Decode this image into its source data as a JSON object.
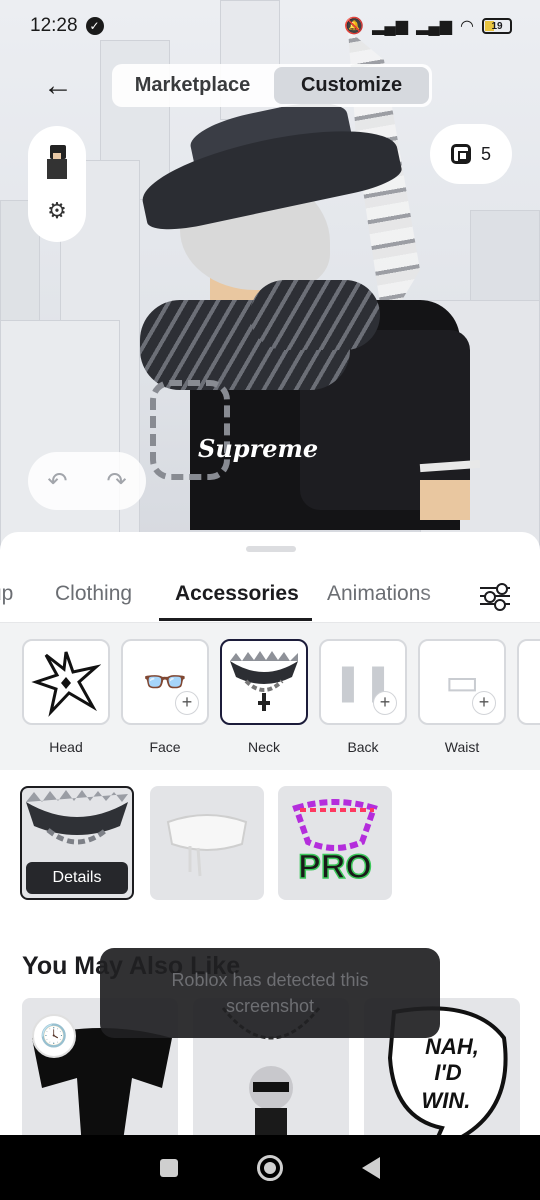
{
  "status_bar": {
    "time": "12:28",
    "battery": "19",
    "icons": [
      "shield-check-icon",
      "mute-icon",
      "signal-icon",
      "signal-icon",
      "wifi-icon",
      "battery-icon"
    ]
  },
  "header": {
    "back_icon": "arrow-left-icon",
    "segments": [
      {
        "label": "Marketplace",
        "active": false
      },
      {
        "label": "Customize",
        "active": true
      }
    ],
    "robux": {
      "icon": "robux-icon",
      "value": "5"
    }
  },
  "tabs": {
    "items": [
      "up",
      "Clothing",
      "Accessories",
      "Animations"
    ],
    "active": "Accessories",
    "filter_icon": "sliders-icon"
  },
  "categories": [
    {
      "label": "Head",
      "selected": false
    },
    {
      "label": "Face",
      "selected": false,
      "icon": "glasses-icon"
    },
    {
      "label": "Neck",
      "selected": true
    },
    {
      "label": "Back",
      "selected": false,
      "icon": "wings-icon"
    },
    {
      "label": "Waist",
      "selected": false,
      "icon": "belt-icon"
    }
  ],
  "owned_items": {
    "details_label": "Details",
    "items": [
      {
        "name": "fur-collar-chain",
        "selected": true
      },
      {
        "name": "white-scarf",
        "selected": false
      },
      {
        "name": "pro-chain",
        "label": "PRO",
        "selected": false
      }
    ]
  },
  "you_may_also_like": {
    "title": "You May Also Like",
    "cards": [
      {
        "name": "black-scarf"
      },
      {
        "name": "character-necklace"
      },
      {
        "name": "nah-id-win-sign",
        "text": "NAH, I'D WIN."
      }
    ]
  },
  "toast": {
    "message": "Roblox has detected this screenshot"
  },
  "avatar_shirt_text": "Supreme",
  "colors": {
    "accent": "#1c1c1f",
    "selected_border": "#1c1c3a",
    "toast_bg": "#202022"
  }
}
